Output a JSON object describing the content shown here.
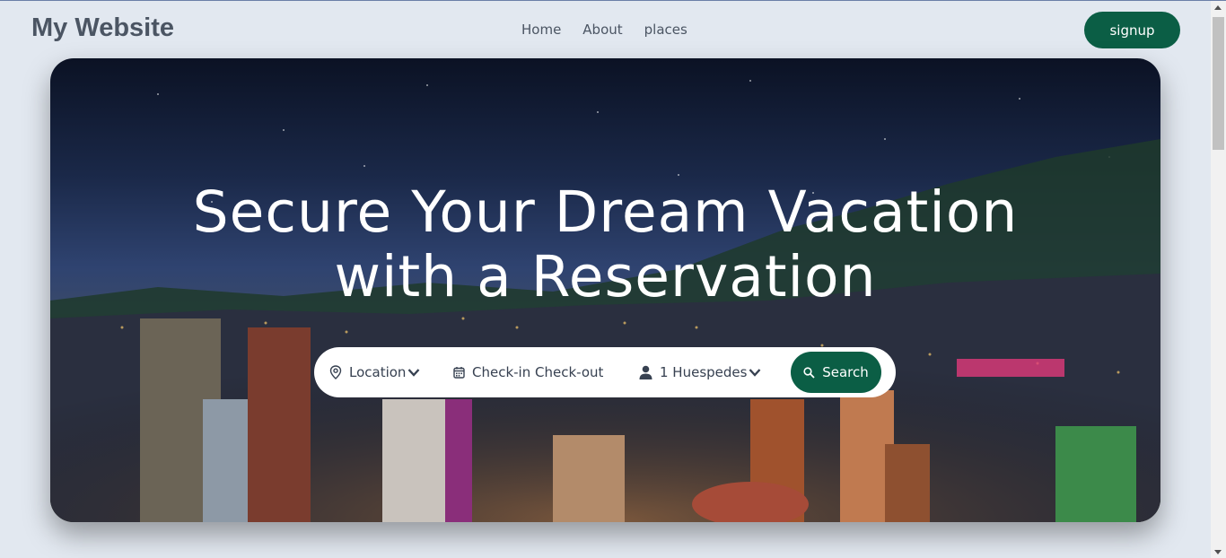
{
  "header": {
    "brand": "My Website",
    "nav": [
      {
        "label": "Home"
      },
      {
        "label": "About"
      },
      {
        "label": "places"
      }
    ],
    "signup_label": "signup"
  },
  "hero": {
    "title_line1": "Secure Your Dream Vacation",
    "title_line2": "with a Reservation"
  },
  "search": {
    "location_label": "Location",
    "dates_label": "Check-in Check-out",
    "guests_label": "1 Huespedes",
    "button_label": "Search"
  },
  "colors": {
    "accent": "#0b5e45",
    "page_bg": "#e2e8f0",
    "text": "#4b5563"
  },
  "icons": {
    "location": "map-pin-icon",
    "dates": "calendar-icon",
    "guests": "user-icon",
    "search": "search-icon",
    "dropdown": "chevron-down-icon"
  }
}
